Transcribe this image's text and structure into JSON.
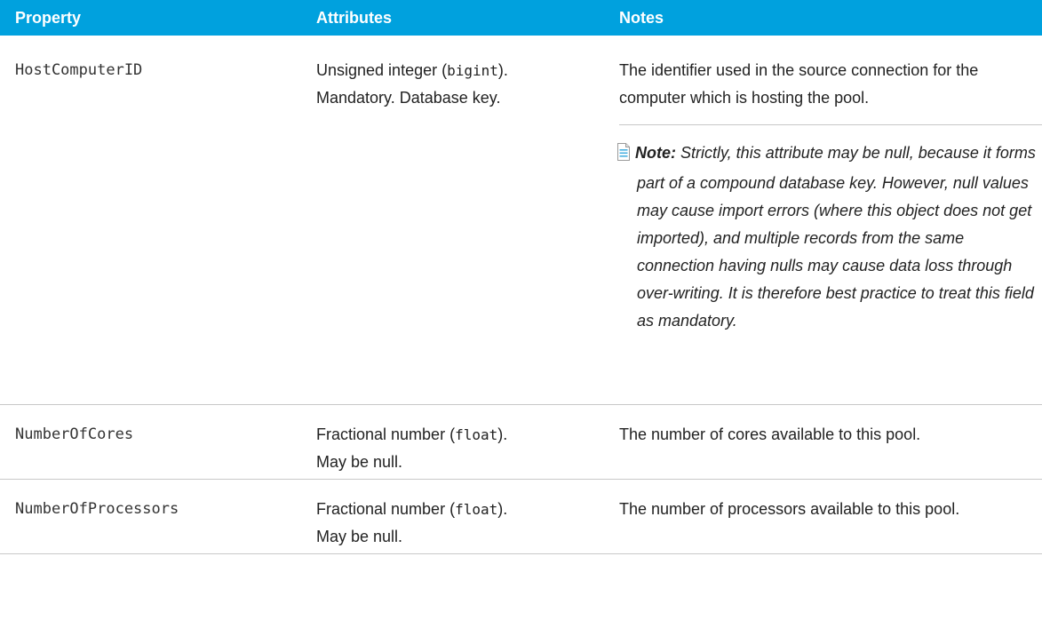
{
  "header": {
    "property": "Property",
    "attributes": "Attributes",
    "notes": "Notes"
  },
  "rows": [
    {
      "property": "HostComputerID",
      "attr_prefix": "Unsigned integer (",
      "attr_code": "bigint",
      "attr_suffix": ").",
      "attr_line2": "Mandatory. Database key.",
      "notes": "The identifier used in the source connection for the computer which is hosting the pool.",
      "note_label": "Note:",
      "note_body": "Strictly, this attribute may be null, because it forms part of a compound database key. However, null values may cause import errors (where this object does not get imported), and multiple records from the same connection having nulls may cause data loss through over-writing. It is therefore best practice to treat this field as mandatory."
    },
    {
      "property": "NumberOfCores",
      "attr_prefix": "Fractional number (",
      "attr_code": "float",
      "attr_suffix": ").",
      "attr_line2": "May be null.",
      "notes": "The number of cores available to this pool."
    },
    {
      "property": "NumberOfProcessors",
      "attr_prefix": "Fractional number (",
      "attr_code": "float",
      "attr_suffix": ").",
      "attr_line2": "May be null.",
      "notes": "The number of processors available to this pool."
    }
  ],
  "colors": {
    "header_bg": "#00a1de",
    "header_text": "#ffffff",
    "border": "#c8c8c8"
  },
  "icons": {
    "note": "note-icon"
  }
}
